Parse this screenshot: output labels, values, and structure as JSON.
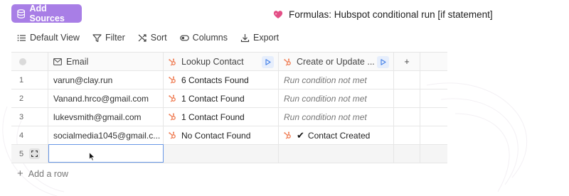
{
  "header": {
    "add_sources_label": "Add Sources",
    "title": "Formulas: Hubspot conditional run [if statement]"
  },
  "toolbar": {
    "default_view": "Default View",
    "filter": "Filter",
    "sort": "Sort",
    "columns": "Columns",
    "export": "Export"
  },
  "table": {
    "columns": [
      "Email",
      "Lookup Contact",
      "Create or Update ..."
    ],
    "rows": [
      {
        "num": "1",
        "email": "varun@clay.run",
        "lookup": "6 Contacts Found",
        "create": "Run condition not met"
      },
      {
        "num": "2",
        "email": "Vanand.hrco@gmail.com",
        "lookup": "1 Contact Found",
        "create": "Run condition not met"
      },
      {
        "num": "3",
        "email": "lukevsmith@gmail.com",
        "lookup": "1 Contact Found",
        "create": "Run condition not met"
      },
      {
        "num": "4",
        "email": "socialmedia1045@gmail.c...",
        "lookup": "No Contact Found",
        "create": "Contact Created"
      }
    ],
    "new_row_num": "5",
    "add_row_label": "Add a row"
  },
  "colors": {
    "accent": "#a87ee6",
    "selection_border": "#6a98e6",
    "hubspot": "#ef7a50"
  }
}
